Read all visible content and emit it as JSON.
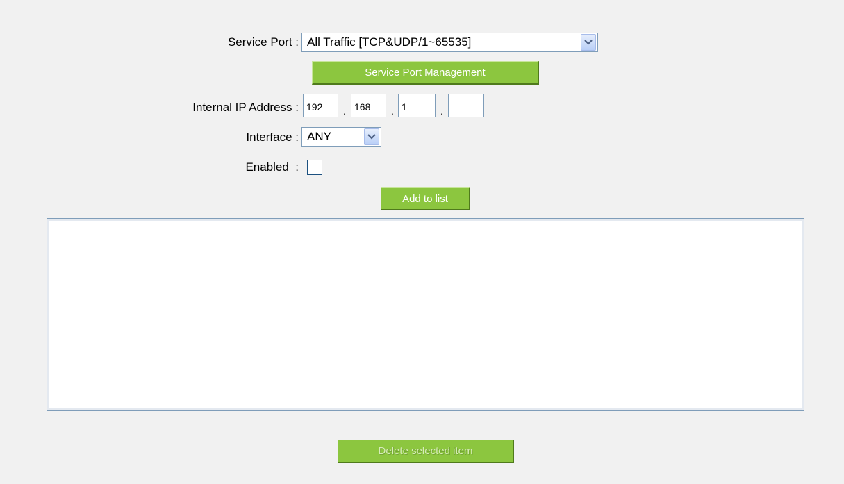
{
  "service_port": {
    "label": "Service Port :",
    "selected": "All Traffic [TCP&UDP/1~65535]",
    "management_button": "Service Port Management"
  },
  "internal_ip": {
    "label": "Internal IP Address :",
    "octets": [
      "192",
      "168",
      "1",
      ""
    ],
    "separator": "."
  },
  "interface": {
    "label": "Interface :",
    "selected": "ANY"
  },
  "enabled": {
    "label": "Enabled  :",
    "checked": false
  },
  "add_button": "Add to list",
  "delete_button": "Delete selected item",
  "colors": {
    "button_green": "#8cc63f",
    "background": "#f1f1f1",
    "field_border": "#7f9db9"
  }
}
